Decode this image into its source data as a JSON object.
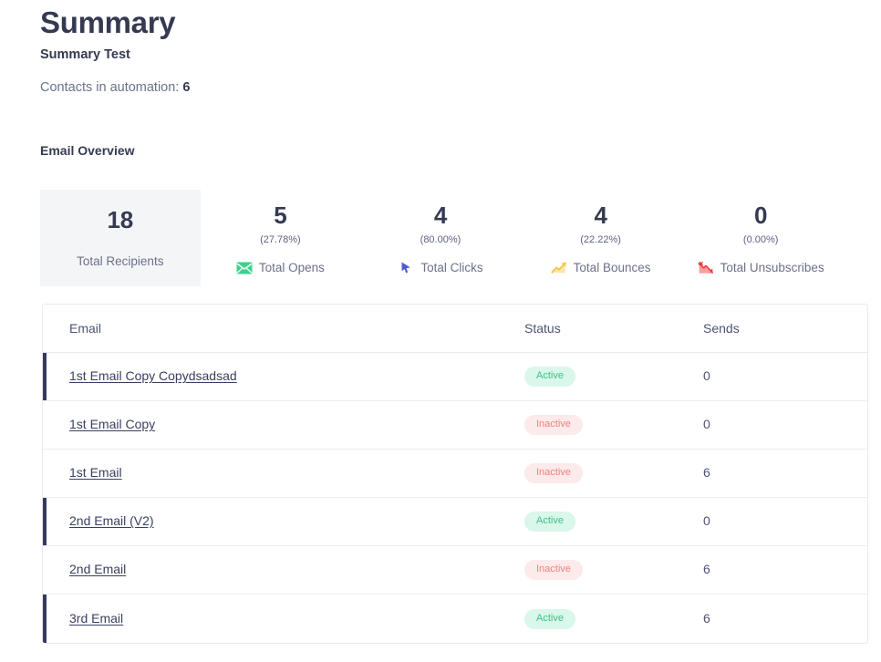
{
  "header": {
    "title": "Summary",
    "subtitle": "Summary Test",
    "contacts_label": "Contacts in automation:",
    "contacts_count": "6"
  },
  "overview": {
    "section_title": "Email Overview",
    "stats": [
      {
        "value": "18",
        "pct": "",
        "label": "Total Recipients",
        "icon": "none",
        "highlight": true
      },
      {
        "value": "5",
        "pct": "(27.78%)",
        "label": "Total Opens",
        "icon": "envelope-icon",
        "highlight": false
      },
      {
        "value": "4",
        "pct": "(80.00%)",
        "label": "Total Clicks",
        "icon": "cursor-icon",
        "highlight": false
      },
      {
        "value": "4",
        "pct": "(22.22%)",
        "label": "Total Bounces",
        "icon": "chart-up-icon",
        "highlight": false
      },
      {
        "value": "0",
        "pct": "(0.00%)",
        "label": "Total Unsubscribes",
        "icon": "chart-down-icon",
        "highlight": false
      }
    ]
  },
  "table": {
    "columns": {
      "email": "Email",
      "status": "Status",
      "sends": "Sends"
    },
    "rows": [
      {
        "email": "1st Email Copy Copydsadsad",
        "status": "Active",
        "sends": "0"
      },
      {
        "email": "1st Email Copy",
        "status": "Inactive",
        "sends": "0"
      },
      {
        "email": "1st Email",
        "status": "Inactive",
        "sends": "6"
      },
      {
        "email": "2nd Email (V2)",
        "status": "Active",
        "sends": "0"
      },
      {
        "email": "2nd Email",
        "status": "Inactive",
        "sends": "6"
      },
      {
        "email": "3rd Email",
        "status": "Active",
        "sends": "6"
      }
    ]
  },
  "colors": {
    "accent_navy": "#343b5c",
    "active_badge_bg": "#d9f7ea",
    "active_badge_text": "#3fc08b",
    "inactive_badge_bg": "#fdeaea",
    "inactive_badge_text": "#f08080",
    "highlight_card_bg": "#f4f5f7"
  }
}
